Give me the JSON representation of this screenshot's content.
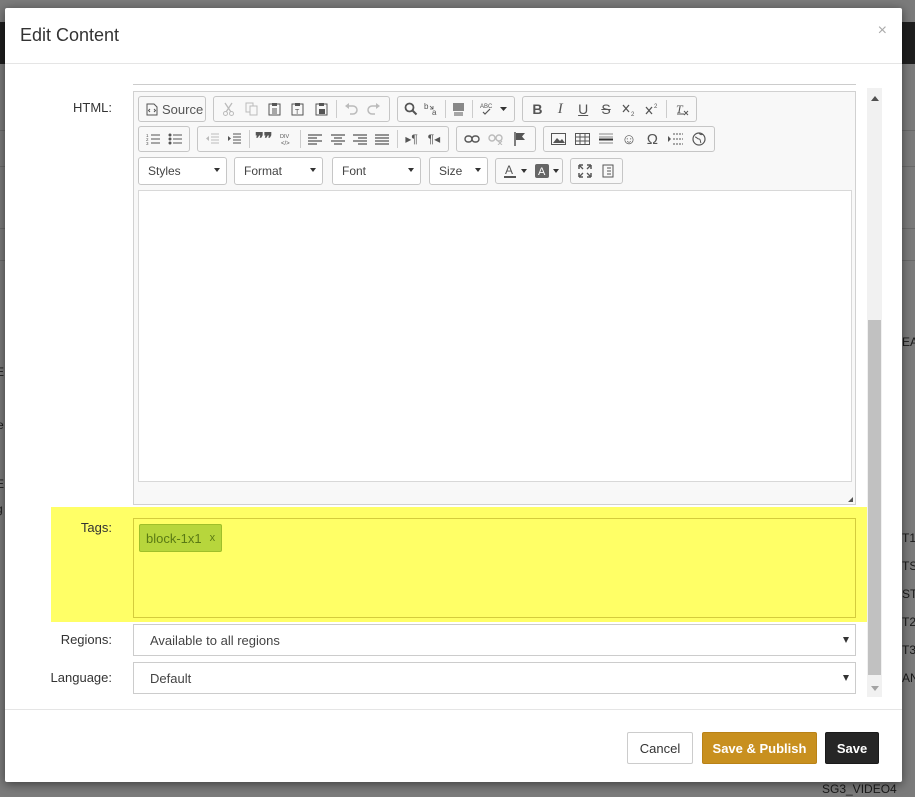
{
  "background": {
    "right_texts": [
      "EA",
      "T1",
      "TS",
      "ST",
      "T2",
      "T3",
      "AN"
    ],
    "left_texts": [
      "E",
      "e",
      "E",
      "g"
    ],
    "bottom_text": "SG3_VIDEO4"
  },
  "modal": {
    "title": "Edit Content",
    "close_label": "×"
  },
  "fields": {
    "html_label": "HTML:",
    "tags_label": "Tags:",
    "regions_label": "Regions:",
    "language_label": "Language:"
  },
  "editor": {
    "source_label": "Source",
    "combos": {
      "styles": "Styles",
      "format": "Format",
      "font": "Font",
      "size": "Size"
    },
    "icons": {
      "abc": "ABC",
      "div": "DIV"
    }
  },
  "tags": [
    {
      "label": "block-1x1",
      "remove": "x"
    }
  ],
  "regions": {
    "value": "Available to all regions"
  },
  "language": {
    "value": "Default"
  },
  "footer": {
    "cancel_label": "Cancel",
    "publish_label": "Save & Publish",
    "save_label": "Save"
  },
  "colors": {
    "highlight": "#ffff66",
    "tag_bg": "#b7d63c",
    "publish_bg": "#c8901f",
    "save_bg": "#262626"
  }
}
